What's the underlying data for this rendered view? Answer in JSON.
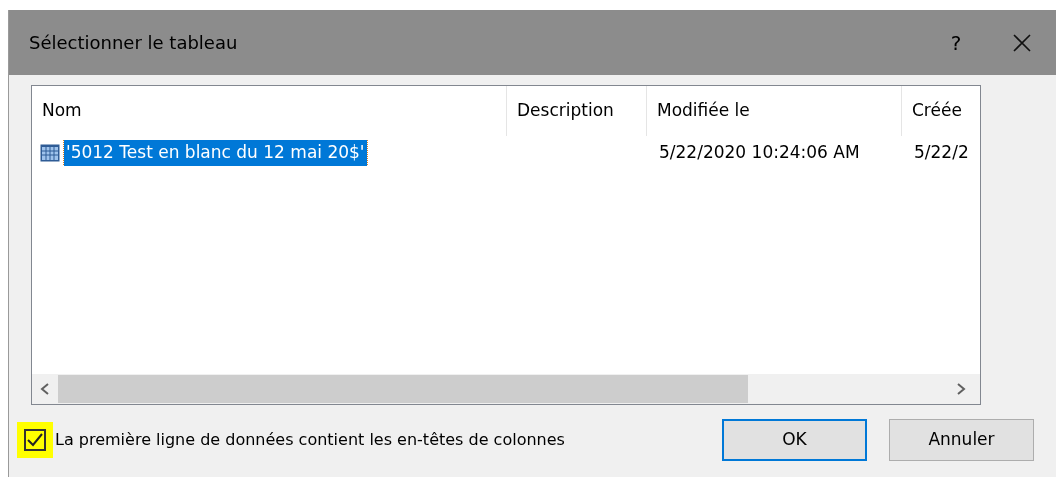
{
  "dialog": {
    "title": "Sélectionner le tableau",
    "help": "?"
  },
  "table": {
    "columns": [
      "Nom",
      "Description",
      "Modifiée le",
      "Créée"
    ],
    "rows": [
      {
        "cells": [
          "'5012 Test en blanc du 12 mai 20$'",
          "",
          "5/22/2020 10:24:06 AM",
          "5/22/2"
        ],
        "selected": true
      }
    ]
  },
  "header_checkbox": {
    "label": "La première ligne de données contient les en-têtes de colonnes",
    "checked": true
  },
  "buttons": [
    {
      "label": "OK",
      "default": true
    },
    {
      "label": "Annuler",
      "default": false
    }
  ]
}
